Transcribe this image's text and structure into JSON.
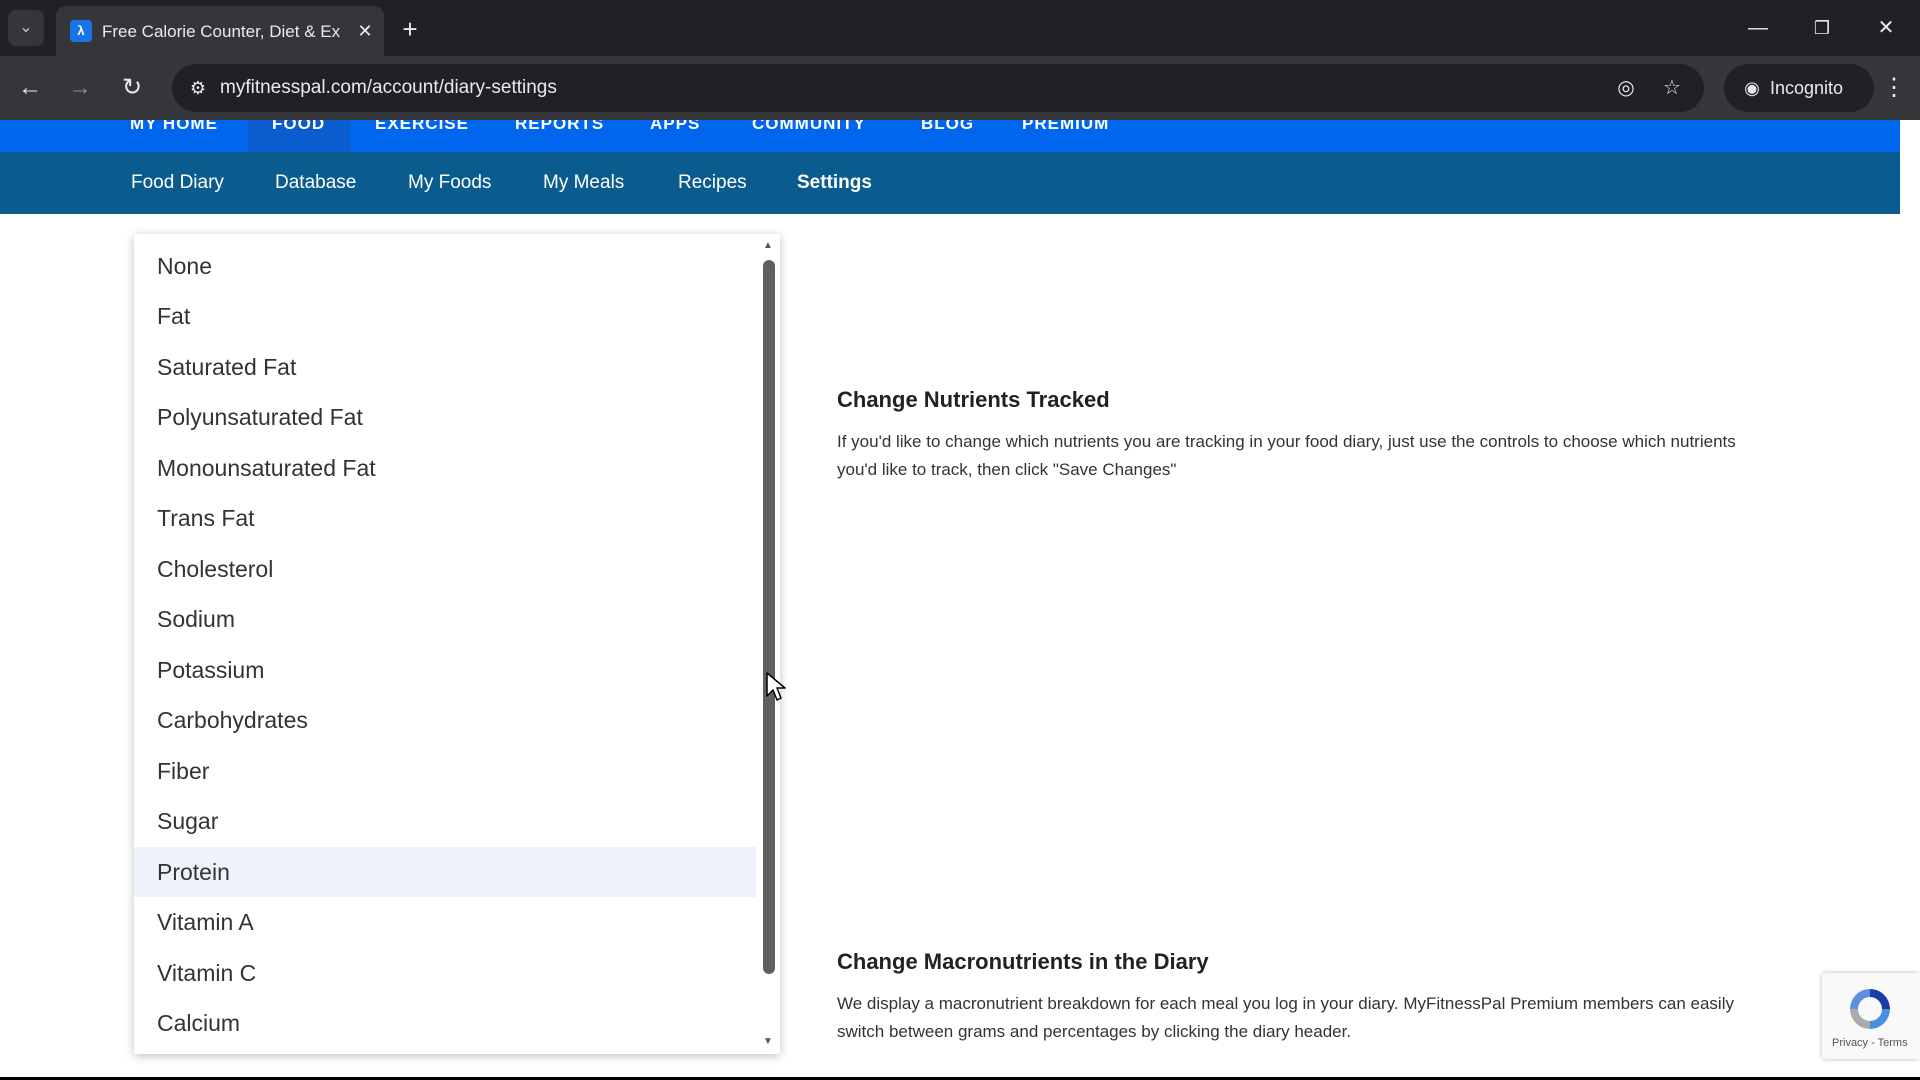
{
  "browser": {
    "tab_title": "Free Calorie Counter, Diet & Ex",
    "url": "myfitnesspal.com/account/diary-settings",
    "incognito_label": "Incognito",
    "icons": [
      "tab-list-icon",
      "favicon",
      "close-icon",
      "plus-icon",
      "minimize-icon",
      "restore-icon",
      "close-window-icon",
      "back-icon",
      "forward-icon",
      "reload-icon",
      "site-info-icon",
      "eye-off-icon",
      "star-icon",
      "incognito-icon",
      "kebab-menu-icon"
    ]
  },
  "site": {
    "top_nav": [
      "MY HOME",
      "FOOD",
      "EXERCISE",
      "REPORTS",
      "APPS",
      "COMMUNITY",
      "BLOG",
      "PREMIUM"
    ],
    "sub_nav": [
      "Food Diary",
      "Database",
      "My Foods",
      "My Meals",
      "Recipes",
      "Settings"
    ],
    "active_top": "FOOD",
    "active_sub": "Settings",
    "colors": {
      "top_nav": "#0066ee",
      "sub_nav": "#0b5c8e"
    }
  },
  "dropdown": {
    "options": [
      "None",
      "Fat",
      "Saturated Fat",
      "Polyunsaturated Fat",
      "Monounsaturated Fat",
      "Trans Fat",
      "Cholesterol",
      "Sodium",
      "Potassium",
      "Carbohydrates",
      "Fiber",
      "Sugar",
      "Protein",
      "Vitamin A",
      "Vitamin C",
      "Calcium"
    ],
    "highlighted": "Protein"
  },
  "sections": {
    "nutrients": {
      "heading": "Change Nutrients Tracked",
      "text": "If you'd like to change which nutrients you are tracking in your food diary, just use the controls to choose which nutrients you'd like to track, then click \"Save Changes\""
    },
    "macros": {
      "heading": "Change Macronutrients in the Diary",
      "text": "We display a macronutrient breakdown for each meal you log in your diary. MyFitnessPal Premium members can easily switch between grams and percentages by clicking the diary header."
    }
  },
  "recaptcha": {
    "links": "Privacy - Terms"
  }
}
